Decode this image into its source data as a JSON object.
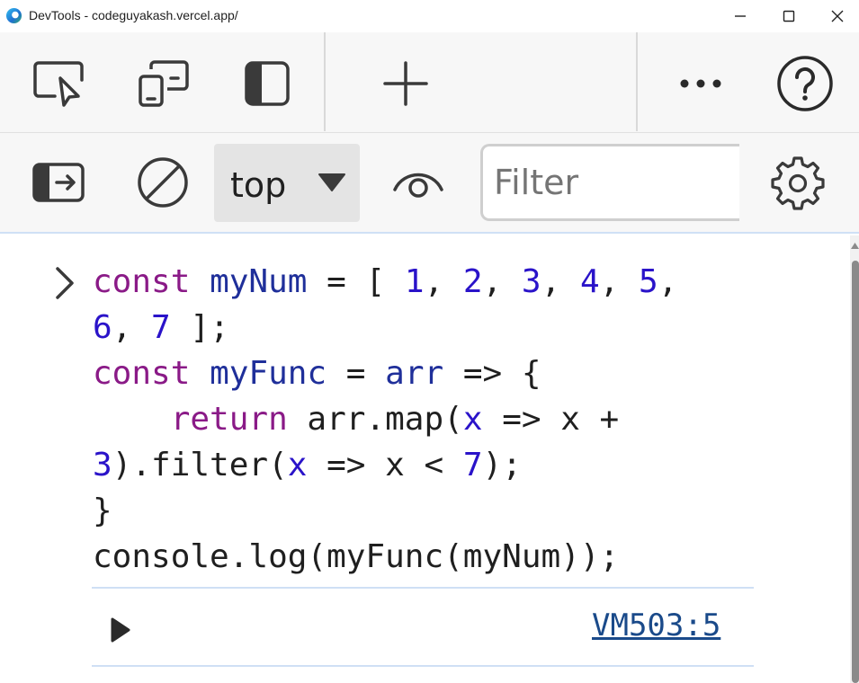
{
  "window": {
    "title": "DevTools - codeguyakash.vercel.app/"
  },
  "toolbar_main": {
    "buttons": [
      {
        "name": "inspect-element",
        "icon": "inspect-icon"
      },
      {
        "name": "device-emulation",
        "icon": "device-icon"
      },
      {
        "name": "dock-side",
        "icon": "dock-icon"
      },
      {
        "name": "add-tab",
        "icon": "plus-icon"
      },
      {
        "name": "more-tools",
        "icon": "ellipsis-icon"
      },
      {
        "name": "help",
        "icon": "help-icon"
      }
    ]
  },
  "console_toolbar": {
    "context": "top",
    "filter_placeholder": "Filter"
  },
  "console": {
    "code_lines": [
      "const myNum = [ 1, 2, 3, 4, 5,",
      "6, 7 ];",
      "const myFunc = arr => {",
      "    return arr.map(x => x +",
      "3).filter(x => x < 7);",
      "}",
      "console.log(myFunc(myNum));"
    ],
    "source_link": "VM503:5"
  },
  "colors": {
    "keyword": "#8a1a87",
    "definition": "#1f2f9a",
    "number": "#2a13c9",
    "link": "#1a4a8a"
  }
}
